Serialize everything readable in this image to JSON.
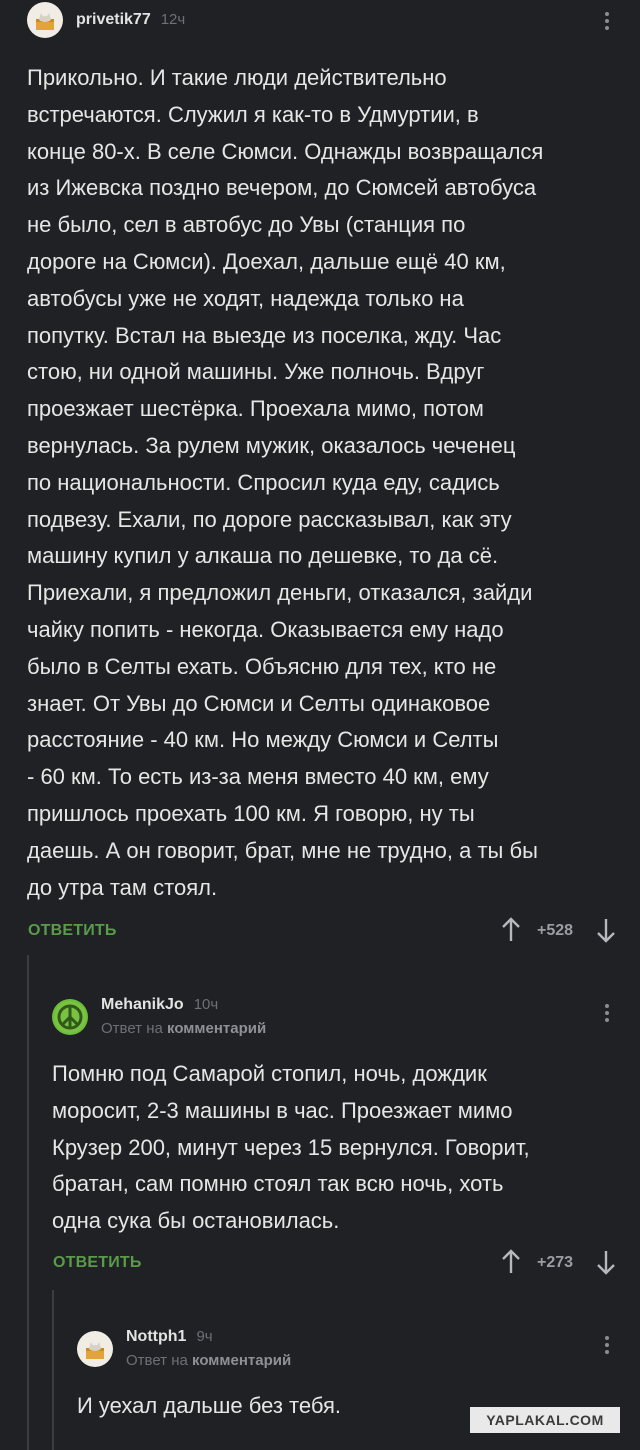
{
  "comments": [
    {
      "nick": "privetik77",
      "time": "12ч",
      "avatar_icon": "cat-in-box-icon",
      "text": "Прикольно. И такие люди действительно\nвстречаются. Служил я как-то в Удмуртии, в\nконце 80-х. В селе Сюмси. Однажды возвращался\nиз Ижевска поздно вечером, до Сюмсей автобуса\nне было, сел в автобус до Увы (станция по\nдороге на Сюмси). Доехал, дальше ещё 40 км,\nавтобусы уже не ходят, надежда только на\nпопутку. Встал на выезде из поселка, жду. Час\nстою, ни одной машины. Уже полночь. Вдруг\nпроезжает шестёрка. Проехала мимо, потом\nвернулась. За рулем мужик, оказалось чеченец\nпо национальности. Спросил куда еду, садись\nподвезу. Ехали, по дороге рассказывал, как эту\nмашину купил у алкаша по дешевке, то да сё.\nПриехали, я предложил деньги, отказался, зайди\nчайку попить - некогда. Оказывается ему надо\nбыло в Селты ехать. Объясню для тех, кто не\nзнает. От Увы до Сюмси и Селты одинаковое\nрасстояние - 40 км. Но между Сюмси и Селты\n- 60 км. То есть из-за меня вместо 40 км, ему\nпришлось проехать 100 км. Я говорю, ну ты\nдаешь. А он говорит, брат, мне не трудно, а ты бы\nдо утра там стоял.",
      "reply_label": "ОТВЕТИТЬ",
      "rating": "+528"
    },
    {
      "nick": "MehanikJo",
      "time": "10ч",
      "avatar_icon": "peace-sign-icon",
      "reply_prefix": "Ответ на",
      "reply_target": "комментарий",
      "text": "Помню под Самарой стопил, ночь, дождик\nморосит, 2-3 машины в час. Проезжает мимо\nКрузер 200, минут через 15 вернулся. Говорит,\nбратан, сам помню стоял так всю ночь, хоть\nодна сука бы остановилась.",
      "reply_label": "ОТВЕТИТЬ",
      "rating": "+273"
    },
    {
      "nick": "Nottph1",
      "time": "9ч",
      "avatar_icon": "cat-in-box-icon",
      "reply_prefix": "Ответ на",
      "reply_target": "комментарий",
      "text": "И уехал дальше без тебя."
    }
  ],
  "watermark": "YAPLAKAL.COM",
  "colors": {
    "background": "#1f2124",
    "accent_green": "#5a9b4a",
    "muted": "#6d7075"
  }
}
